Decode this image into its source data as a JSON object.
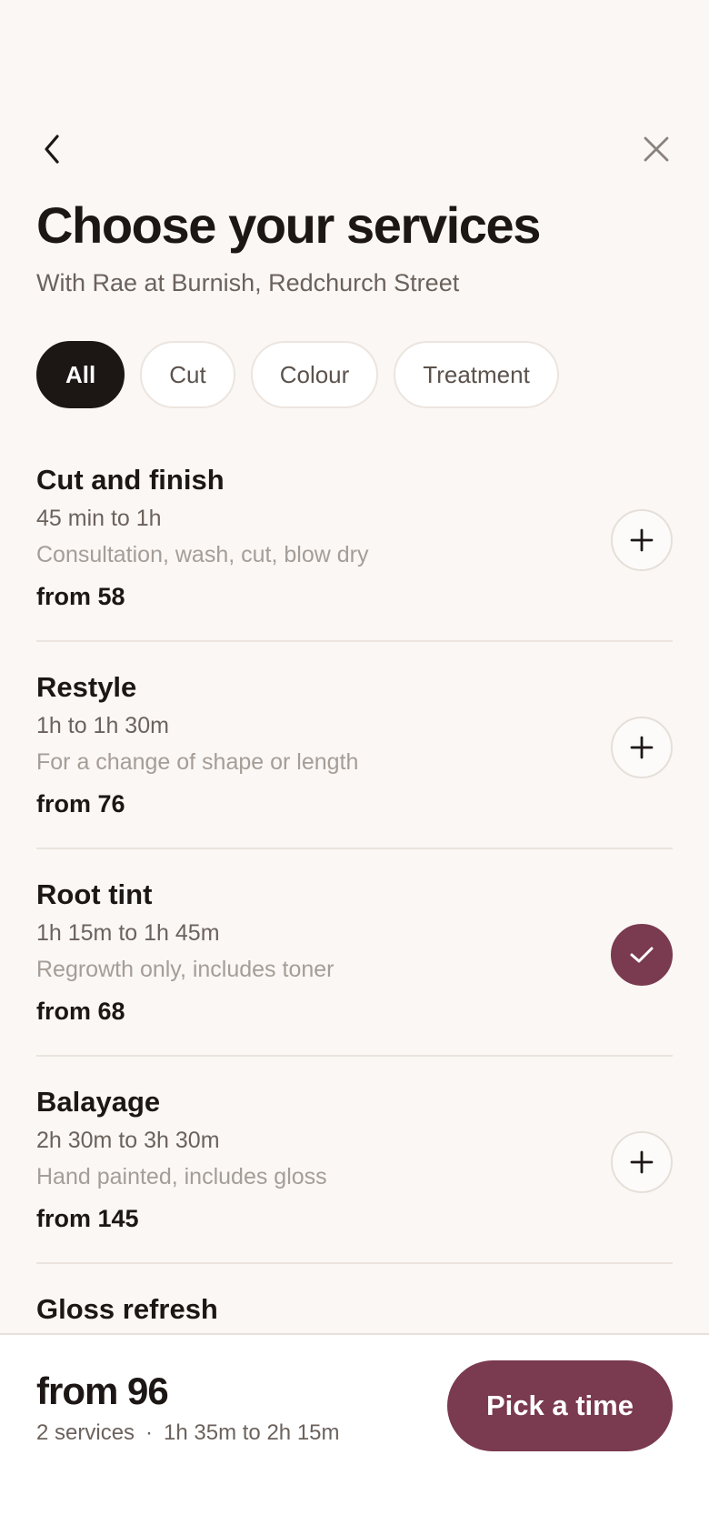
{
  "header": {
    "back_icon": "chevron-left-icon",
    "close_icon": "close-icon",
    "title": "Choose your services",
    "subtitle": "With Rae at Burnish, Redchurch Street"
  },
  "filters": [
    {
      "label": "All",
      "active": true
    },
    {
      "label": "Cut",
      "active": false
    },
    {
      "label": "Colour",
      "active": false
    },
    {
      "label": "Treatment",
      "active": false
    }
  ],
  "services": [
    {
      "name": "Cut and finish",
      "duration": "45 min to 1h",
      "description": "Consultation, wash, cut, blow dry",
      "price": "from 58",
      "selected": false,
      "icon": "plus-icon"
    },
    {
      "name": "Restyle",
      "duration": "1h to 1h 30m",
      "description": "For a change of shape or length",
      "price": "from 76",
      "selected": false,
      "icon": "plus-icon"
    },
    {
      "name": "Root tint",
      "duration": "1h 15m to 1h 45m",
      "description": "Regrowth only, includes toner",
      "price": "from 68",
      "selected": true,
      "icon": "check-icon"
    },
    {
      "name": "Balayage",
      "duration": "2h 30m to 3h 30m",
      "description": "Hand painted, includes gloss",
      "price": "from 145",
      "selected": false,
      "icon": "plus-icon"
    },
    {
      "name": "Gloss refresh"
    }
  ],
  "summary": {
    "price": "from 96",
    "count": "2 services",
    "separator": "·",
    "duration": "1h 35m to 2h 15m",
    "cta_label": "Pick a time"
  },
  "colors": {
    "background": "#faf7f4",
    "text": "#1c1715",
    "accent": "#7a3a50",
    "muted": "#6c625d",
    "subtle": "#a59d97"
  }
}
